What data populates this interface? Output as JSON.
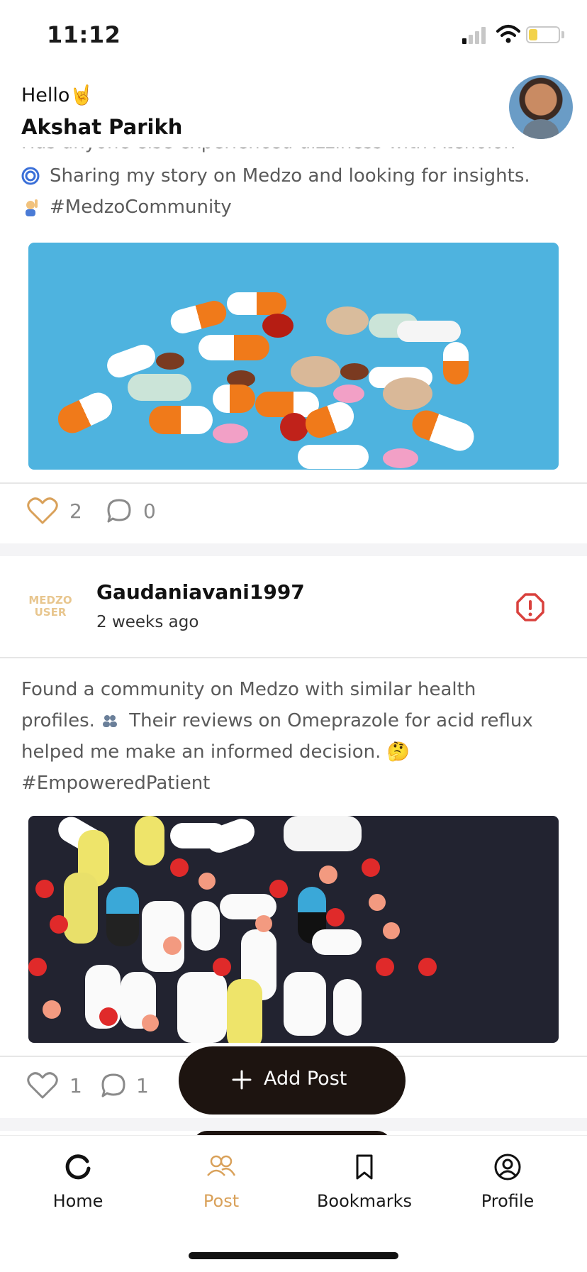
{
  "status_bar": {
    "time": "11:12"
  },
  "header": {
    "greeting": "Hello🤘",
    "user_name": "Akshat Parikh"
  },
  "post1": {
    "cut_text": "Has anyone else experienced dizziness with Atenolol?",
    "lines": [
      "Sharing my story on Medzo and looking for insights.",
      "#MedzoCommunity"
    ],
    "likes": "2",
    "comments": "0"
  },
  "post2": {
    "logo_line1": "MEDZO",
    "logo_line2": "USER",
    "author": "Gaudaniavani1997",
    "time_ago": "2 weeks ago",
    "text_line1": "Found a community on Medzo with similar health",
    "text_line2a": "profiles. ",
    "text_line2b": "Their reviews on Omeprazole for acid reflux",
    "text_line3": "helped me make an informed decision. 🤔",
    "text_line4": "#EmpoweredPatient",
    "likes": "1",
    "comments": "1"
  },
  "add_post": {
    "label": "Add Post"
  },
  "bottom_nav": {
    "items": [
      {
        "label": "Home",
        "icon": "home-icon"
      },
      {
        "label": "Post",
        "icon": "community-icon"
      },
      {
        "label": "Bookmarks",
        "icon": "bookmark-icon"
      },
      {
        "label": "Profile",
        "icon": "profile-icon"
      }
    ],
    "active": "Post"
  },
  "colors": {
    "accent": "#d9a15a",
    "dark": "#1d1410",
    "report": "#d9413d"
  }
}
